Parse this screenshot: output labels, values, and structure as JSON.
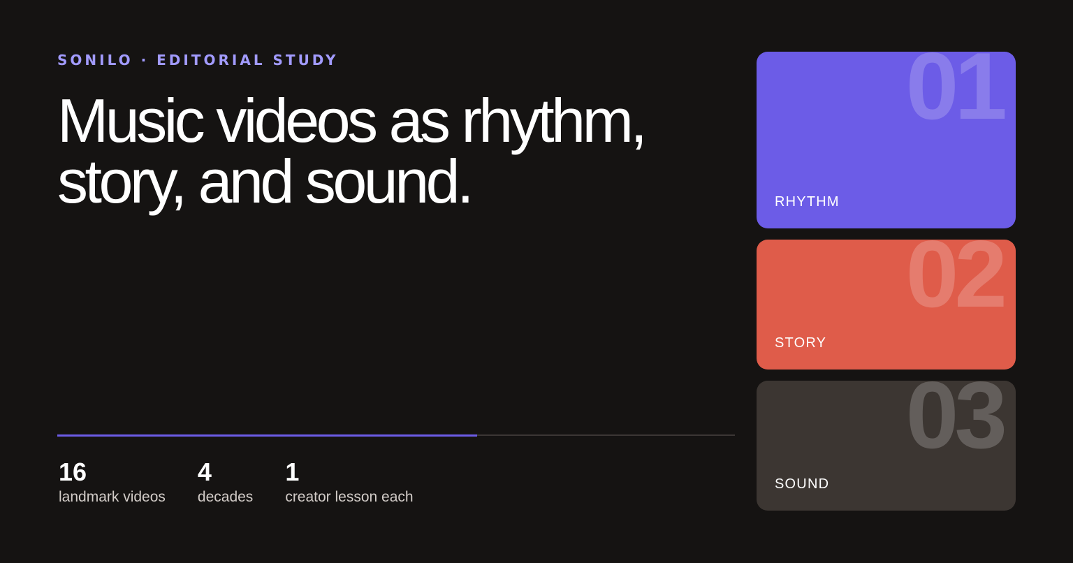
{
  "header": {
    "eyebrow": "SONILO · EDITORIAL STUDY",
    "headline": "Music videos as rhythm, story, and sound."
  },
  "progress": {
    "fraction": 0.62
  },
  "stats": [
    {
      "value": "16",
      "label": "landmark videos"
    },
    {
      "value": "4",
      "label": "decades"
    },
    {
      "value": "1",
      "label": "creator lesson each"
    }
  ],
  "cards": [
    {
      "number": "01",
      "label": "RHYTHM",
      "color": "#6c5ce7"
    },
    {
      "number": "02",
      "label": "STORY",
      "color": "#df5c4a"
    },
    {
      "number": "03",
      "label": "SOUND",
      "color": "#3c3632"
    }
  ],
  "colors": {
    "background": "#151312",
    "accent": "#a29bfe",
    "progress_fill": "#6c5ce7"
  }
}
